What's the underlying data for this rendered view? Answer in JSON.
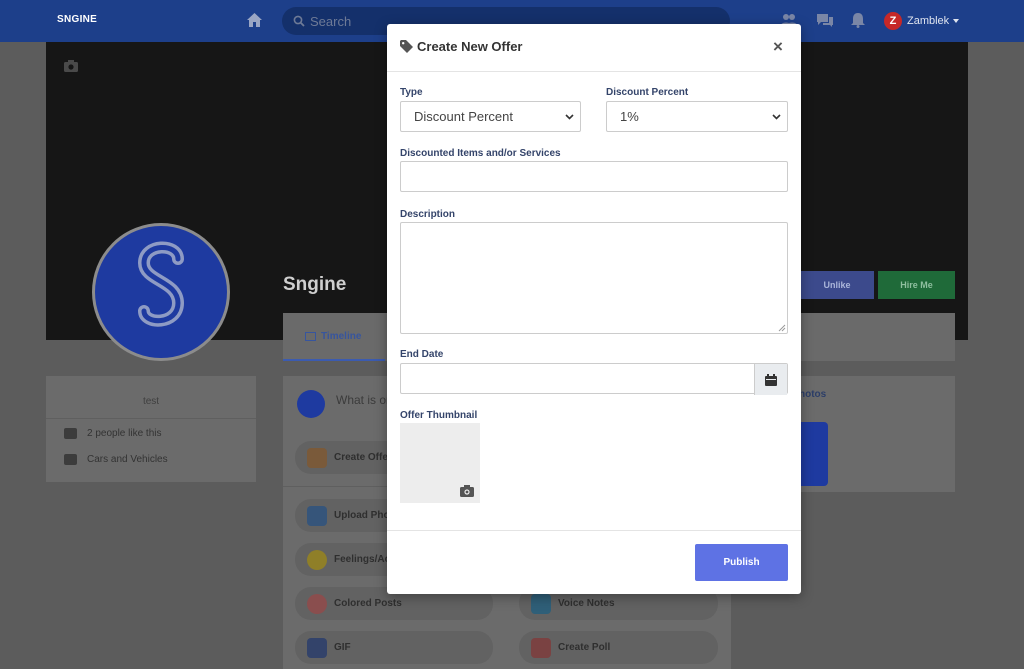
{
  "app": {
    "brand": "SNGINE",
    "search_placeholder": "Search",
    "user_initial": "Z",
    "user_name": "Zamblek"
  },
  "profile": {
    "name": "Sngine",
    "unlike_label": "Unlike",
    "hire_label": "Hire Me",
    "tab_timeline": "Timeline"
  },
  "left_card": {
    "title": "test",
    "likes": "2 people like this",
    "category": "Cars and Vehicles"
  },
  "composer": {
    "placeholder": "What is on",
    "create_offer": "Create Offe",
    "upload_photo": "Upload Pho",
    "feelings": "Feelings/Ac",
    "colored_posts": "Colored Posts",
    "voice_notes": "Voice Notes",
    "gif": "GIF",
    "create_poll": "Create Poll"
  },
  "right_card": {
    "title": "hotos"
  },
  "modal": {
    "title": "Create New Offer",
    "close": "×",
    "type_label": "Type",
    "type_value": "Discount Percent",
    "discount_label": "Discount Percent",
    "discount_value": "1%",
    "items_label": "Discounted Items and/or Services",
    "items_value": "",
    "description_label": "Description",
    "description_value": "",
    "end_date_label": "End Date",
    "end_date_value": "",
    "thumbnail_label": "Offer Thumbnail",
    "publish_label": "Publish"
  },
  "colors": {
    "topbar": "#1d3f8a",
    "accent": "#5e72e4",
    "overlay_bg": "#5c5c5c"
  }
}
